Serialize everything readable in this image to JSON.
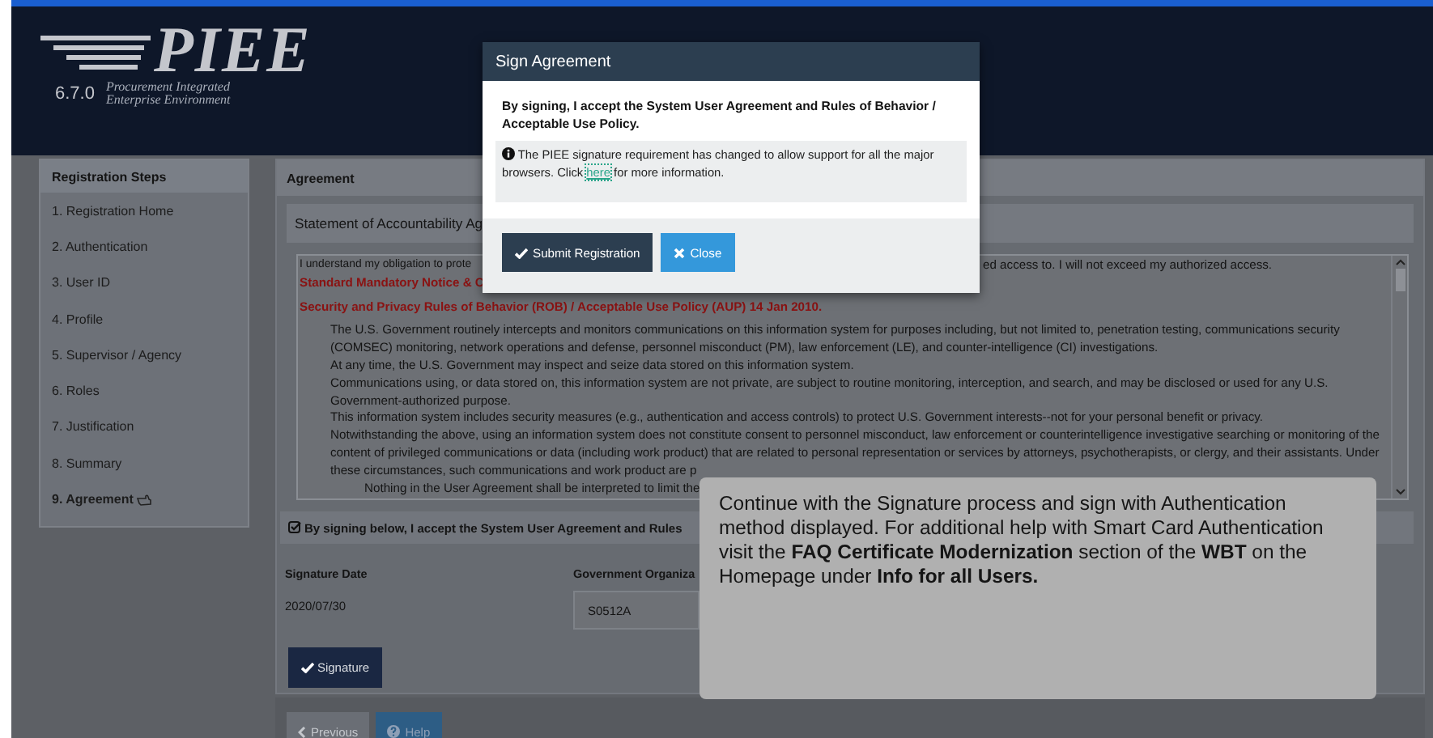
{
  "header": {
    "logo": "PIEE",
    "version": "6.7.0",
    "logo_subtitle": [
      "Procurement Integrated",
      "Enterprise Environment"
    ]
  },
  "sidebar": {
    "title": "Registration Steps",
    "items": [
      {
        "label": "1. Registration Home",
        "selected": false
      },
      {
        "label": "2. Authentication",
        "selected": false
      },
      {
        "label": "3. User ID",
        "selected": false
      },
      {
        "label": "4. Profile",
        "selected": false
      },
      {
        "label": "5. Supervisor / Agency",
        "selected": false
      },
      {
        "label": "6. Roles",
        "selected": false
      },
      {
        "label": "7. Justification",
        "selected": false
      },
      {
        "label": "8. Summary",
        "selected": false
      },
      {
        "label": "9. Agreement",
        "selected": true
      }
    ]
  },
  "main": {
    "title": "Agreement",
    "statement_title": "Statement of Accountability Ag",
    "agreement": {
      "first_line_left": "I understand my obligation to prote",
      "first_line_right": "ed access to. I will not exceed my authorized access.",
      "notice": "Standard Mandatory Notice & C",
      "rob_title": "Security and Privacy Rules of Behavior (ROB) / Acceptable Use Policy (AUP) 14 Jan 2010.",
      "paragraphs": [
        {
          "kind": "normal",
          "text": "The U.S. Government routinely intercepts and monitors communications on this information system for purposes including, but not limited to, penetration testing, communications security (COMSEC) monitoring, network operations and defense, personnel misconduct (PM), law enforcement (LE), and counter-intelligence (CI) investigations."
        },
        {
          "kind": "normal",
          "text": "At any time, the U.S. Government may inspect and seize data stored on this information system."
        },
        {
          "kind": "normal",
          "text": "Communications using, or data stored on, this information system are not private, are subject to routine monitoring, interception, and search, and may be disclosed or used for any U.S. Government-authorized purpose."
        },
        {
          "kind": "normal",
          "text": "This information system includes security measures (e.g., authentication and access controls) to protect U.S. Government interests--not for your personal benefit or privacy."
        },
        {
          "kind": "normal",
          "text": "Notwithstanding the above, using an information system does not constitute consent to personnel misconduct, law enforcement or counterintelligence investigative searching or monitoring of the content of privileged communications or data (including work product) that are related to personal representation or services by attorneys, psychotherapists, or clergy, and their assistants. Under these circumstances, such communications and work product are p"
        },
        {
          "kind": "indented",
          "text": "Nothing in the User Agreement shall be interpreted to limit the"
        }
      ]
    },
    "accept_text": "By signing below, I accept the System User Agreement and Rules",
    "fields": [
      {
        "kind": "text",
        "label": "Signature Date",
        "value": "2020/07/30"
      },
      {
        "kind": "input",
        "label": "Government Organiza",
        "value": "S0512A"
      }
    ],
    "signature_button": "Signature",
    "footer_buttons": [
      {
        "kind": "previous",
        "label": "Previous"
      },
      {
        "kind": "help",
        "label": "Help"
      }
    ]
  },
  "modal": {
    "title": "Sign Agreement",
    "statement": "By signing, I accept the System User Agreement and Rules of Behavior / Acceptable Use Policy.",
    "info_before": "The PIEE signature requirement has changed to allow support for all the major browsers. Click",
    "info_link": "here",
    "info_after": "for more information.",
    "buttons": [
      {
        "kind": "primary",
        "label": "Submit Registration"
      },
      {
        "kind": "close",
        "label": "Close"
      }
    ]
  },
  "callout": {
    "text": "Continue with the Signature process and sign with Authentication method displayed. For additional help with Smart Card Authentication visit the **FAQ Certificate Modernization** section of the **WBT** on the Homepage under **Info for all Users.**"
  }
}
